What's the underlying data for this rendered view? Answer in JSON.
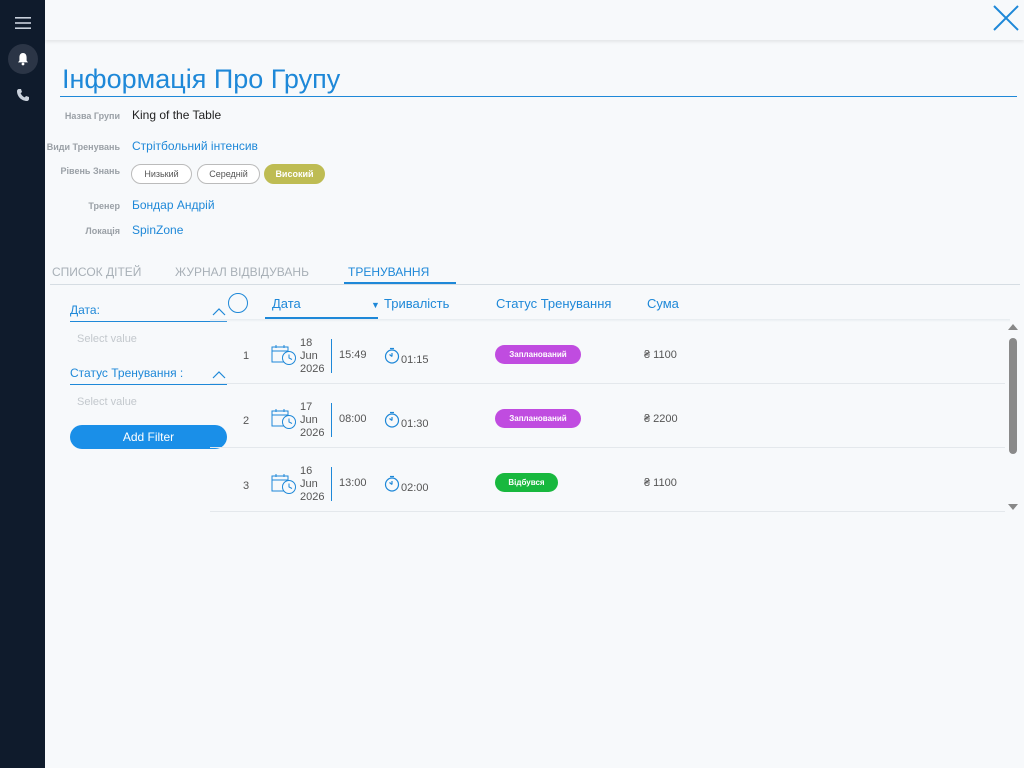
{
  "title": "Інформація Про Групу",
  "info": {
    "group_name": {
      "label": "Назва Групи",
      "value": "King of the Table"
    },
    "training_types": {
      "label": "Види Тренувань",
      "value": "Стрітбольний інтенсив"
    },
    "knowledge_level": {
      "label": "Рівень Знань",
      "options": [
        "Низький",
        "Середній",
        "Високий"
      ],
      "selected": "Високий"
    },
    "coach": {
      "label": "Тренер",
      "value": "Бондар Андрій"
    },
    "location": {
      "label": "Локація",
      "value": "SpinZone"
    }
  },
  "tabs": [
    {
      "label": "СПИСОК ДІТЕЙ",
      "active": false
    },
    {
      "label": "ЖУРНАЛ ВІДВІДУВАНЬ",
      "active": false
    },
    {
      "label": "ТРЕНУВАННЯ",
      "active": true
    }
  ],
  "filters": {
    "date": {
      "label": "Дата:",
      "placeholder": "Select value"
    },
    "status": {
      "label": "Статус Тренування :",
      "placeholder": "Select value"
    },
    "add_button": "Add Filter"
  },
  "table": {
    "columns": {
      "date": "Дата",
      "duration": "Тривалість",
      "status": "Статус Тренування",
      "sum": "Сума"
    },
    "rows": [
      {
        "num": "1",
        "day": "18",
        "month": "Jun",
        "year": "2026",
        "time": "15:49",
        "duration": "01:15",
        "status": "Запланований",
        "status_color": "#c04ce0",
        "sum": "₴ 1100"
      },
      {
        "num": "2",
        "day": "17",
        "month": "Jun",
        "year": "2026",
        "time": "08:00",
        "duration": "01:30",
        "status": "Запланований",
        "status_color": "#c04ce0",
        "sum": "₴ 2200"
      },
      {
        "num": "3",
        "day": "16",
        "month": "Jun",
        "year": "2026",
        "time": "13:00",
        "duration": "02:00",
        "status": "Відбувся",
        "status_color": "#18b83e",
        "sum": "₴ 1100"
      }
    ]
  },
  "colors": {
    "accent": "#1e88d8",
    "sidebar": "#0f1b2c",
    "level_active": "#bebc53",
    "planned": "#c04ce0",
    "done": "#18b83e"
  },
  "icons": [
    "menu-icon",
    "bell-icon",
    "phone-icon",
    "close-icon",
    "calendar-icon",
    "timer-icon"
  ]
}
